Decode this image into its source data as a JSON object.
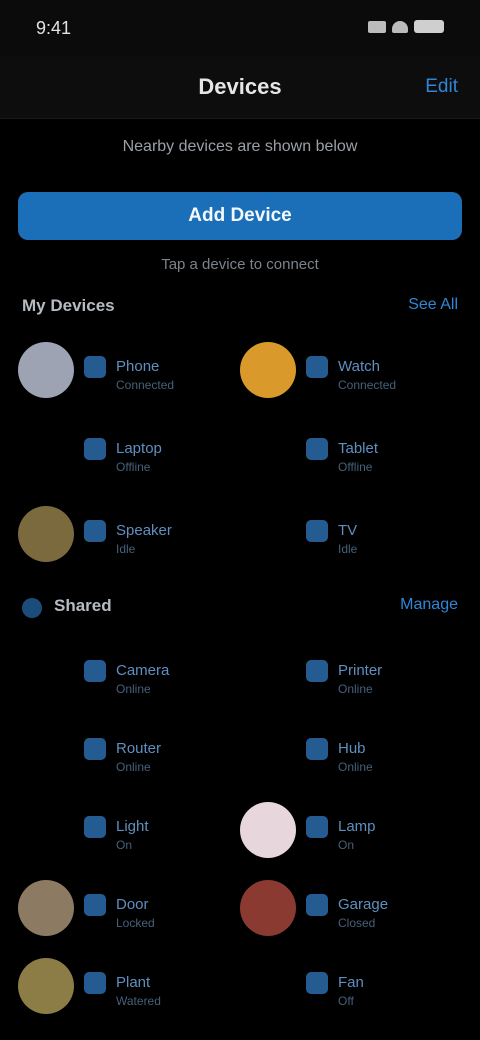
{
  "status_bar": {
    "time": "9:41"
  },
  "header": {
    "title": "Devices",
    "action": "Edit"
  },
  "info": {
    "line": "Nearby devices are shown below",
    "sub": "Tap a device to connect"
  },
  "primary_button": {
    "label": "Add Device"
  },
  "sections": [
    {
      "title": "My Devices",
      "link": "See All",
      "items": [
        {
          "label": "Phone",
          "sub": "Connected",
          "avatar": "#9ea3b3"
        },
        {
          "label": "Watch",
          "sub": "Connected",
          "avatar": "#d99a2b"
        },
        {
          "label": "Laptop",
          "sub": "Offline",
          "avatar": null
        },
        {
          "label": "Tablet",
          "sub": "Offline",
          "avatar": null
        },
        {
          "label": "Speaker",
          "sub": "Idle",
          "avatar": "#7a6a3e"
        },
        {
          "label": "TV",
          "sub": "Idle",
          "avatar": null
        }
      ]
    },
    {
      "title": "Shared",
      "link": "Manage",
      "items": [
        {
          "label": "Camera",
          "sub": "Online",
          "avatar": null
        },
        {
          "label": "Printer",
          "sub": "Online",
          "avatar": null
        },
        {
          "label": "Router",
          "sub": "Online",
          "avatar": null
        },
        {
          "label": "Hub",
          "sub": "Online",
          "avatar": null
        },
        {
          "label": "Light",
          "sub": "On",
          "avatar": null
        },
        {
          "label": "Lamp",
          "sub": "On",
          "avatar": "#e7d6dc"
        },
        {
          "label": "Door",
          "sub": "Locked",
          "avatar": "#8c7a62"
        },
        {
          "label": "Garage",
          "sub": "Closed",
          "avatar": "#8a3a30"
        },
        {
          "label": "Plant",
          "sub": "Watered",
          "avatar": "#8b7d45"
        },
        {
          "label": "Fan",
          "sub": "Off",
          "avatar": null
        }
      ]
    }
  ],
  "colors": {
    "accent": "#1a6fb8",
    "link": "#2f86d6",
    "background": "#000000"
  }
}
